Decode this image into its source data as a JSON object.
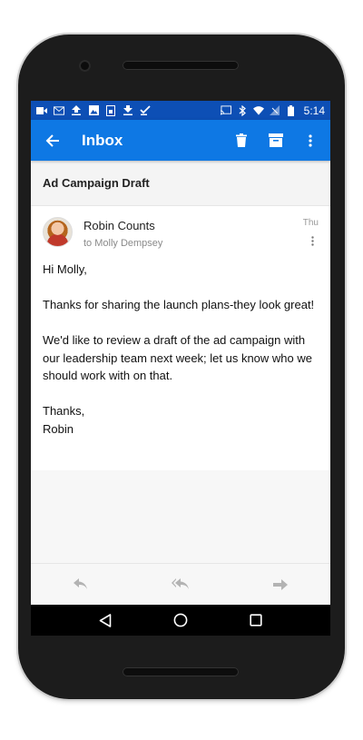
{
  "status_bar": {
    "time": "5:14",
    "left_icons": [
      "video-icon",
      "mail-icon",
      "upload-icon",
      "image-icon",
      "sim-icon",
      "download-icon",
      "checklist-icon"
    ],
    "right_icons": [
      "cast-icon",
      "bluetooth-icon",
      "wifi-icon",
      "no-signal-icon",
      "battery-icon"
    ]
  },
  "app_bar": {
    "title": "Inbox",
    "actions": [
      "delete-icon",
      "archive-icon",
      "more-vert-icon"
    ],
    "color": "#0e78e4"
  },
  "email": {
    "subject": "Ad Campaign Draft",
    "sender": "Robin Counts",
    "recipient": "to Molly Dempsey",
    "date": "Thu",
    "body": [
      "Hi Molly,",
      "Thanks for sharing the launch plans-they look great!",
      "We'd like to review a draft of the ad campaign with our leadership team next week; let us know who we should work with on that.",
      "Thanks,\nRobin"
    ]
  },
  "toolbar": {
    "buttons": [
      "reply-icon",
      "reply-all-icon",
      "forward-icon"
    ]
  },
  "nav_bar": {
    "buttons": [
      "back-triangle-icon",
      "home-circle-icon",
      "recents-square-icon"
    ]
  }
}
